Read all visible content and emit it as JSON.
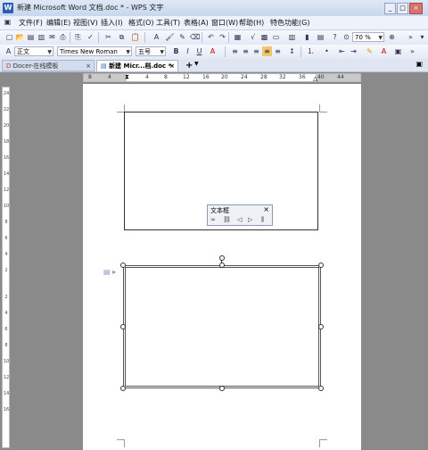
{
  "window": {
    "title": "新建 Microsoft Word 文档.doc * - WPS 文字",
    "app_icon": "W"
  },
  "menu": [
    "文件(F)",
    "编辑(E)",
    "视图(V)",
    "插入(I)",
    "格式(O)",
    "工具(T)",
    "表格(A)",
    "窗口(W)",
    "帮助(H)",
    "特色功能(G)"
  ],
  "toolbar": {
    "zoom": "70 %",
    "style": "正文",
    "font": "Times New Roman",
    "size": "五号",
    "bold": "B",
    "italic": "I",
    "underline": "U",
    "font_color": "A"
  },
  "tabs": [
    {
      "label": "Docer-在线模板"
    },
    {
      "label": "新建 Micr...档.doc *"
    }
  ],
  "tab_add": "+",
  "ruler": {
    "h_numbers": [
      "8",
      "4",
      "4",
      "8",
      "12",
      "16",
      "20",
      "24",
      "28",
      "32",
      "36",
      "40",
      "44"
    ],
    "v_numbers": [
      "24",
      "22",
      "20",
      "18",
      "16",
      "14",
      "12",
      "10",
      "8",
      "6",
      "4",
      "2",
      "2",
      "4",
      "6",
      "8",
      "10",
      "12",
      "14",
      "16"
    ]
  },
  "textbox_toolbar": {
    "title": "文本框",
    "close": "×"
  }
}
